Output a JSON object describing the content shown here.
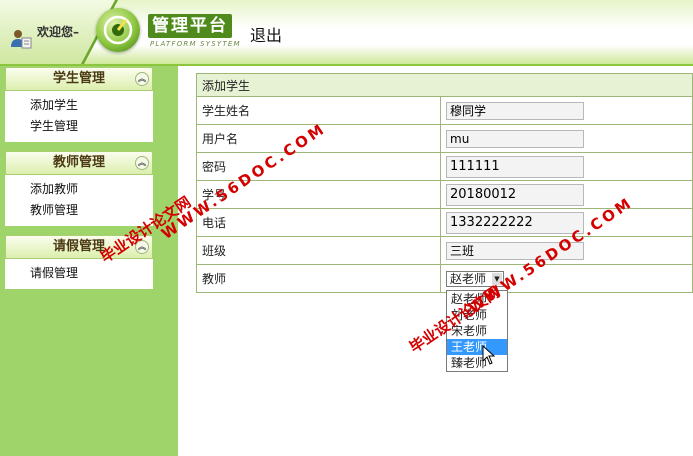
{
  "header": {
    "welcome": "欢迎您–",
    "brand": "管理平台",
    "brand_sub": "PLATFORM SYSYTEM",
    "logout": "退出"
  },
  "sidebar": {
    "groups": [
      {
        "title": "学生管理",
        "items": [
          "添加学生",
          "学生管理"
        ]
      },
      {
        "title": "教师管理",
        "items": [
          "添加教师",
          "教师管理"
        ]
      },
      {
        "title": "请假管理",
        "items": [
          "请假管理"
        ]
      }
    ]
  },
  "form": {
    "caption": "添加学生",
    "rows": [
      {
        "label": "学生姓名",
        "value": "穆同学"
      },
      {
        "label": "用户名",
        "value": "mu"
      },
      {
        "label": "密码",
        "value": "111111"
      },
      {
        "label": "学号",
        "value": "20180012"
      },
      {
        "label": "电话",
        "value": "1332222222"
      },
      {
        "label": "班级",
        "value": "三班"
      }
    ],
    "teacher_label": "教师",
    "teacher_selected": "赵老师",
    "teacher_options": [
      "赵老师",
      "刘老师",
      "宋老师",
      "王老师",
      "臻老师"
    ],
    "highlighted_option": "王老师"
  },
  "watermarks": {
    "url": "WWW.56DOC.COM",
    "site": "毕业设计论文网"
  },
  "colors": {
    "sidebar_bg": "#9fd46a",
    "brand_bg": "#4e8a1c",
    "selected_option": "#3399ff",
    "watermark": "#d40000"
  }
}
